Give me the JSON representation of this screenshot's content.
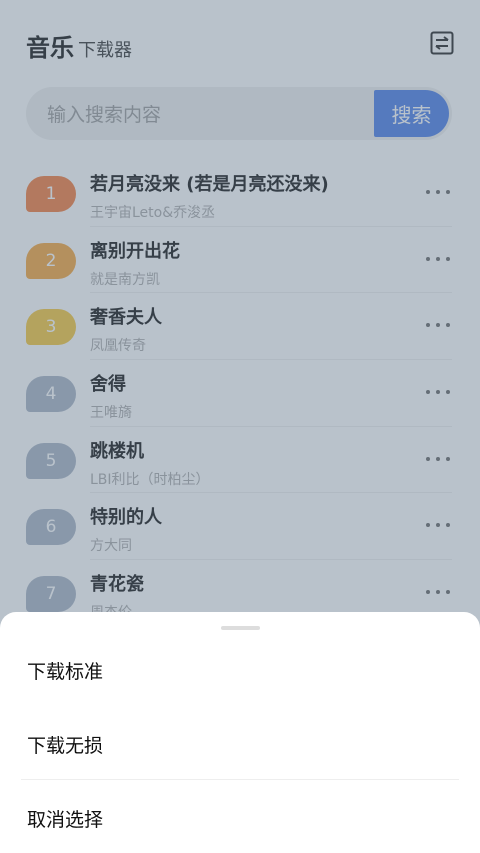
{
  "header": {
    "title": "音乐",
    "subtitle": "下载器",
    "swap_icon": "swap-list-icon"
  },
  "search": {
    "placeholder": "输入搜索内容",
    "value": "",
    "button_label": "搜索"
  },
  "songs": [
    {
      "rank": "1",
      "title": "若月亮没来 (若是月亮还没来)",
      "artist": "王宇宙Leto&乔浚丞",
      "rank_color": "#f47b3b"
    },
    {
      "rank": "2",
      "title": "离别开出花",
      "artist": "就是南方凯",
      "rank_color": "#f6a43a"
    },
    {
      "rank": "3",
      "title": "奢香夫人",
      "artist": "凤凰传奇",
      "rank_color": "#f6c63a"
    },
    {
      "rank": "4",
      "title": "舍得",
      "artist": "王唯旖",
      "rank_color": "#a8b3c4"
    },
    {
      "rank": "5",
      "title": "跳楼机",
      "artist": "LBI利比（时柏尘）",
      "rank_color": "#a8b3c4"
    },
    {
      "rank": "6",
      "title": "特别的人",
      "artist": "方大同",
      "rank_color": "#a8b3c4"
    },
    {
      "rank": "7",
      "title": "青花瓷",
      "artist": "周杰伦",
      "rank_color": "#a8b3c4"
    }
  ],
  "sheet": {
    "options": [
      "下载标准",
      "下载无损",
      "取消选择"
    ]
  },
  "colors": {
    "accent": "#4a7de8",
    "scrim": "rgba(100,120,140,0.45)"
  }
}
